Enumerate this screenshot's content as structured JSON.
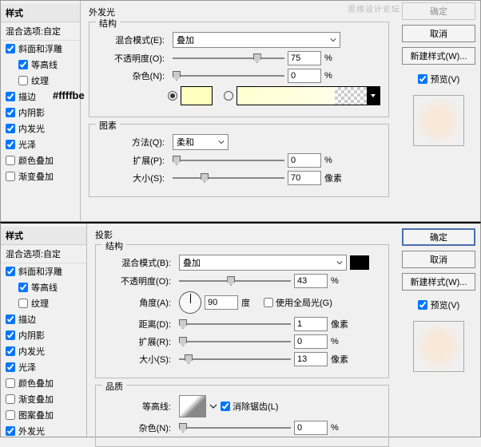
{
  "watermark": "思缘设计论坛",
  "top": {
    "sidebar": {
      "title": "样式",
      "blending": "混合选项:自定",
      "items": [
        {
          "label": "斜面和浮雕",
          "checked": true,
          "indent": false
        },
        {
          "label": "等高线",
          "checked": true,
          "indent": true
        },
        {
          "label": "纹理",
          "checked": false,
          "indent": true
        },
        {
          "label": "描边",
          "checked": true,
          "indent": false
        },
        {
          "label": "内阴影",
          "checked": true,
          "indent": false
        },
        {
          "label": "内发光",
          "checked": true,
          "indent": false
        },
        {
          "label": "光泽",
          "checked": true,
          "indent": false
        },
        {
          "label": "颜色叠加",
          "checked": false,
          "indent": false
        },
        {
          "label": "渐变叠加",
          "checked": false,
          "indent": false
        }
      ]
    },
    "main": {
      "title": "外发光",
      "group1": "结构",
      "blendMode": {
        "label": "混合模式(E):",
        "value": "叠加"
      },
      "opacity": {
        "label": "不透明度(O):",
        "value": "75",
        "unit": "%"
      },
      "noise": {
        "label": "杂色(N):",
        "value": "0",
        "unit": "%"
      },
      "hex": "#ffffbe",
      "group2": "图素",
      "technique": {
        "label": "方法(Q):",
        "value": "柔和"
      },
      "spread": {
        "label": "扩展(P):",
        "value": "0",
        "unit": "%"
      },
      "size": {
        "label": "大小(S):",
        "value": "70",
        "unit": "像素"
      }
    },
    "right": {
      "ok": "确定",
      "cancel": "取消",
      "newstyle": "新建样式(W)...",
      "preview": "预览(V)"
    }
  },
  "bottom": {
    "sidebar": {
      "title": "样式",
      "blending": "混合选项:自定",
      "items": [
        {
          "label": "斜面和浮雕",
          "checked": true,
          "indent": false
        },
        {
          "label": "等高线",
          "checked": true,
          "indent": true
        },
        {
          "label": "纹理",
          "checked": false,
          "indent": true
        },
        {
          "label": "描边",
          "checked": true,
          "indent": false
        },
        {
          "label": "内阴影",
          "checked": true,
          "indent": false
        },
        {
          "label": "内发光",
          "checked": true,
          "indent": false
        },
        {
          "label": "光泽",
          "checked": true,
          "indent": false
        },
        {
          "label": "颜色叠加",
          "checked": false,
          "indent": false
        },
        {
          "label": "渐变叠加",
          "checked": false,
          "indent": false
        },
        {
          "label": "图案叠加",
          "checked": false,
          "indent": false
        },
        {
          "label": "外发光",
          "checked": true,
          "indent": false
        }
      ]
    },
    "main": {
      "title": "投影",
      "group1": "结构",
      "blendMode": {
        "label": "混合模式(B):",
        "value": "叠加"
      },
      "opacity": {
        "label": "不透明度(O):",
        "value": "43",
        "unit": "%"
      },
      "angle": {
        "label": "角度(A):",
        "value": "90",
        "unit": "度"
      },
      "globalLight": "使用全局光(G)",
      "distance": {
        "label": "距离(D):",
        "value": "1",
        "unit": "像素"
      },
      "spread": {
        "label": "扩展(R):",
        "value": "0",
        "unit": "%"
      },
      "size": {
        "label": "大小(S):",
        "value": "13",
        "unit": "像素"
      },
      "group2": "品质",
      "contour": {
        "label": "等高线:"
      },
      "antialias": "消除锯齿(L)",
      "noise": {
        "label": "杂色(N):",
        "value": "0",
        "unit": "%"
      }
    },
    "right": {
      "ok": "确定",
      "cancel": "取消",
      "newstyle": "新建样式(W)...",
      "preview": "预览(V)"
    }
  }
}
